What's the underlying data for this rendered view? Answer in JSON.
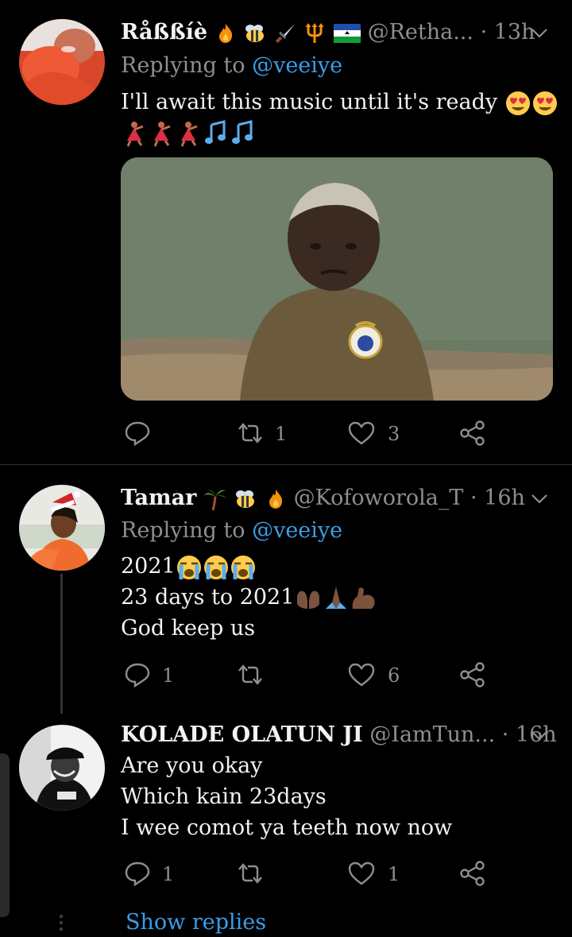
{
  "tweets": [
    {
      "name": "Råßßíè",
      "name_emojis": [
        "fire",
        "bee",
        "dagger",
        "trident",
        "lesotho-flag"
      ],
      "handle": "@Retha...",
      "time": "· 13h",
      "replying_prefix": "Replying to ",
      "replying_to": "@veeiye",
      "text_lines": [
        "I'll await this music until it's ready",
        ""
      ],
      "text_emojis_line1": [
        "heart-eyes",
        "heart-eyes"
      ],
      "text_emojis_line2": [
        "dancer",
        "dancer",
        "dancer",
        "music-notes",
        "music-notes"
      ],
      "actions": {
        "reply_count": "",
        "retweet_count": "1",
        "like_count": "3"
      }
    },
    {
      "name": "Tamar",
      "name_emojis": [
        "palm-tree",
        "bee",
        "fire"
      ],
      "handle": "@Kofoworola_T",
      "time": "· 16h",
      "replying_prefix": "Replying to ",
      "replying_to": "@veeiye",
      "text_lines": [
        "2021",
        "23 days to 2021",
        "God keep us"
      ],
      "actions": {
        "reply_count": "1",
        "retweet_count": "",
        "like_count": "6"
      }
    },
    {
      "name": "KOLADE OLATUN JI",
      "handle": "@IamTun...",
      "time": "· 16h",
      "text_lines": [
        "Are you okay",
        "Which kain 23days",
        "I wee comot ya teeth now now"
      ],
      "actions": {
        "reply_count": "1",
        "retweet_count": "",
        "like_count": "1"
      }
    }
  ],
  "show_replies": "Show replies",
  "colors": {
    "background": "#000000",
    "link": "#3a9de8",
    "muted": "#8b8f94",
    "text": "#f2f2f2"
  }
}
